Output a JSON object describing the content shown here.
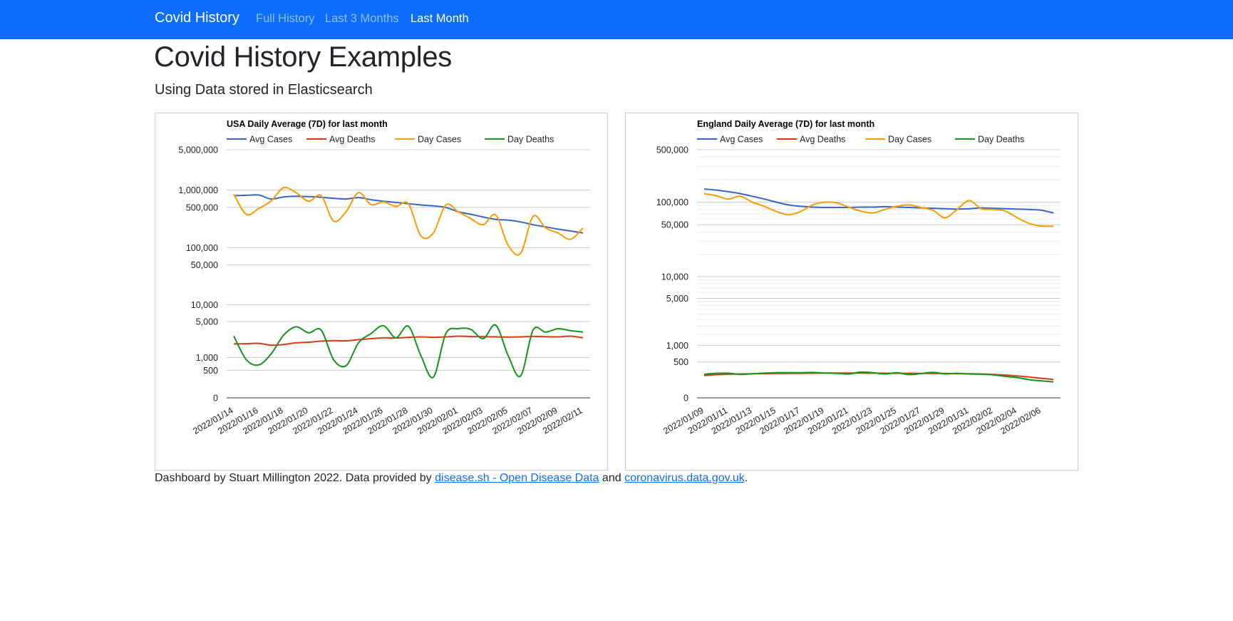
{
  "navbar": {
    "brand": "Covid History",
    "links": [
      {
        "label": "Full History",
        "active": false
      },
      {
        "label": "Last 3 Months",
        "active": false
      },
      {
        "label": "Last Month",
        "active": true
      }
    ]
  },
  "header": {
    "title": "Covid History Examples",
    "subtitle": "Using Data stored in Elasticsearch"
  },
  "footer": {
    "prefix": "Dashboard by Stuart Millington 2022. Data provided by ",
    "link1": "disease.sh - Open Disease Data",
    "middle": " and ",
    "link2": "coronavirus.data.gov.uk",
    "suffix": "."
  },
  "colors": {
    "avg_cases": "#3366cc",
    "avg_deaths": "#dc3912",
    "day_cases": "#ff9900",
    "day_deaths": "#109618",
    "navbar": "#0d6efd"
  },
  "chart_data": [
    {
      "type": "line",
      "title": "USA Daily Average (7D) for last month",
      "xlabel": "",
      "ylabel": "",
      "yscale": "log",
      "legend": "top",
      "grid": true,
      "yticks": [
        {
          "label": "5,000,000",
          "value": 5000000
        },
        {
          "label": "1,000,000",
          "value": 1000000
        },
        {
          "label": "500,000",
          "value": 500000
        },
        {
          "label": "100,000",
          "value": 100000
        },
        {
          "label": "50,000",
          "value": 50000
        },
        {
          "label": "10,000",
          "value": 10000
        },
        {
          "label": "5,000",
          "value": 5000
        },
        {
          "label": "1,000",
          "value": 1000
        },
        {
          "label": "500",
          "value": 500
        },
        {
          "label": "0",
          "value": 0
        }
      ],
      "xticks": [
        "2022/01/14",
        "2022/01/16",
        "2022/01/18",
        "2022/01/20",
        "2022/01/22",
        "2022/01/24",
        "2022/01/26",
        "2022/01/28",
        "2022/01/30",
        "2022/02/01",
        "2022/02/03",
        "2022/02/05",
        "2022/02/07",
        "2022/02/09",
        "2022/02/11"
      ],
      "x": [
        "2022/01/14",
        "2022/01/15",
        "2022/01/16",
        "2022/01/17",
        "2022/01/18",
        "2022/01/19",
        "2022/01/20",
        "2022/01/21",
        "2022/01/22",
        "2022/01/23",
        "2022/01/24",
        "2022/01/25",
        "2022/01/26",
        "2022/01/27",
        "2022/01/28",
        "2022/01/29",
        "2022/01/30",
        "2022/01/31",
        "2022/02/01",
        "2022/02/02",
        "2022/02/03",
        "2022/02/04",
        "2022/02/05",
        "2022/02/06",
        "2022/02/07",
        "2022/02/08",
        "2022/02/09",
        "2022/02/10",
        "2022/02/11"
      ],
      "series": [
        {
          "name": "Avg Cases",
          "color": "#3366cc",
          "values": [
            800000,
            810000,
            820000,
            700000,
            760000,
            780000,
            770000,
            750000,
            720000,
            700000,
            740000,
            680000,
            640000,
            610000,
            580000,
            550000,
            530000,
            500000,
            420000,
            380000,
            340000,
            310000,
            300000,
            280000,
            250000,
            230000,
            210000,
            195000,
            180000
          ]
        },
        {
          "name": "Avg Deaths",
          "color": "#dc3912",
          "values": [
            1900,
            1920,
            1950,
            1800,
            1850,
            2000,
            2050,
            2150,
            2200,
            2180,
            2300,
            2400,
            2500,
            2480,
            2550,
            2600,
            2550,
            2600,
            2680,
            2640,
            2620,
            2600,
            2580,
            2600,
            2650,
            2620,
            2600,
            2680,
            2500
          ]
        },
        {
          "name": "Day Cases",
          "color": "#ff9900",
          "values": [
            850000,
            380000,
            480000,
            650000,
            1100000,
            900000,
            640000,
            800000,
            290000,
            420000,
            900000,
            560000,
            620000,
            520000,
            580000,
            160000,
            180000,
            550000,
            420000,
            320000,
            250000,
            370000,
            110000,
            80000,
            350000,
            220000,
            180000,
            140000,
            220000
          ]
        },
        {
          "name": "Day Deaths",
          "color": "#109618",
          "values": [
            2700,
            900,
            680,
            1200,
            2800,
            4000,
            3100,
            3500,
            900,
            650,
            2000,
            3000,
            4200,
            2500,
            4100,
            1100,
            320,
            3000,
            3700,
            3600,
            2400,
            4300,
            1100,
            350,
            3500,
            3200,
            3700,
            3400,
            3200
          ]
        }
      ]
    },
    {
      "type": "line",
      "title": "England Daily Average (7D) for last month",
      "xlabel": "",
      "ylabel": "",
      "yscale": "log",
      "legend": "top",
      "grid": true,
      "yticks": [
        {
          "label": "500,000",
          "value": 500000
        },
        {
          "label": "100,000",
          "value": 100000
        },
        {
          "label": "50,000",
          "value": 50000
        },
        {
          "label": "10,000",
          "value": 10000
        },
        {
          "label": "5,000",
          "value": 5000
        },
        {
          "label": "1,000",
          "value": 1000
        },
        {
          "label": "500",
          "value": 500
        },
        {
          "label": "0",
          "value": 0
        }
      ],
      "xticks": [
        "2022/01/09",
        "2022/01/11",
        "2022/01/13",
        "2022/01/15",
        "2022/01/17",
        "2022/01/19",
        "2022/01/21",
        "2022/01/23",
        "2022/01/25",
        "2022/01/27",
        "2022/01/29",
        "2022/01/31",
        "2022/02/02",
        "2022/02/04",
        "2022/02/06"
      ],
      "x": [
        "2022/01/09",
        "2022/01/10",
        "2022/01/11",
        "2022/01/12",
        "2022/01/13",
        "2022/01/14",
        "2022/01/15",
        "2022/01/16",
        "2022/01/17",
        "2022/01/18",
        "2022/01/19",
        "2022/01/20",
        "2022/01/21",
        "2022/01/22",
        "2022/01/23",
        "2022/01/24",
        "2022/01/25",
        "2022/01/26",
        "2022/01/27",
        "2022/01/28",
        "2022/01/29",
        "2022/01/30",
        "2022/01/31",
        "2022/02/01",
        "2022/02/02",
        "2022/02/03",
        "2022/02/04",
        "2022/02/05",
        "2022/02/06",
        "2022/02/07"
      ],
      "series": [
        {
          "name": "Avg Cases",
          "color": "#3366cc",
          "values": [
            150000,
            145000,
            138000,
            130000,
            120000,
            110000,
            100000,
            92000,
            88000,
            86000,
            85000,
            85000,
            85000,
            86000,
            86000,
            87000,
            86000,
            85000,
            84000,
            83000,
            82000,
            81000,
            82000,
            84000,
            83000,
            82000,
            81000,
            80000,
            78000,
            72000
          ]
        },
        {
          "name": "Avg Deaths",
          "color": "#dc3912",
          "values": [
            245,
            258,
            265,
            270,
            272,
            275,
            278,
            280,
            280,
            282,
            283,
            284,
            284,
            283,
            282,
            281,
            280,
            280,
            279,
            278,
            276,
            274,
            272,
            270,
            262,
            252,
            238,
            222,
            205,
            188
          ]
        },
        {
          "name": "Day Cases",
          "color": "#ff9900",
          "values": [
            130000,
            122000,
            110000,
            120000,
            100000,
            88000,
            75000,
            68000,
            75000,
            92000,
            100000,
            98000,
            86000,
            76000,
            72000,
            80000,
            88000,
            92000,
            85000,
            78000,
            62000,
            80000,
            105000,
            82000,
            80000,
            76000,
            62000,
            52000,
            48000,
            48000
          ]
        },
        {
          "name": "Day Deaths",
          "color": "#109618",
          "values": [
            265,
            280,
            282,
            262,
            272,
            282,
            290,
            292,
            290,
            294,
            285,
            280,
            268,
            300,
            290,
            270,
            290,
            260,
            275,
            295,
            270,
            280,
            270,
            265,
            255,
            232,
            215,
            185,
            170,
            158
          ]
        }
      ]
    }
  ]
}
